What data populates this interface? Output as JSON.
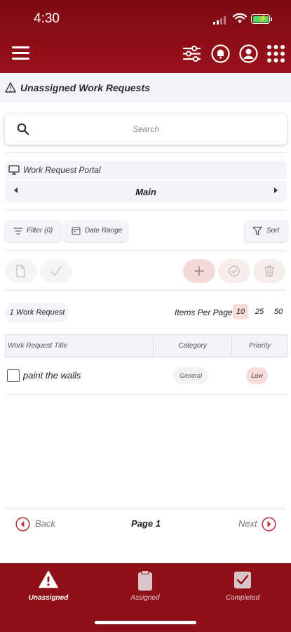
{
  "status_bar": {
    "time": "4:30"
  },
  "header": {
    "title": "Unassigned Work Requests"
  },
  "search": {
    "placeholder": "Search"
  },
  "portal": {
    "label": "Work Request Portal",
    "selected": "Main"
  },
  "filters": {
    "filter_label": "Filter (0)",
    "date_range_label": "Date Range",
    "sort_label": "Sort"
  },
  "list_info": {
    "count_label": "1 Work Request",
    "items_per_page_label": "Items Per Page",
    "page_size_options": [
      "10",
      "25",
      "50"
    ],
    "selected_page_size": "10"
  },
  "table": {
    "columns": [
      "Work Request Title",
      "Category",
      "Priority"
    ],
    "rows": [
      {
        "title": "paint the walls",
        "category": "General",
        "priority": "Low"
      }
    ]
  },
  "pagination": {
    "back_label": "Back",
    "page_label": "Page 1",
    "next_label": "Next"
  },
  "bottom_nav": {
    "items": [
      {
        "label": "Unassigned",
        "icon": "warning-icon",
        "active": true
      },
      {
        "label": "Assigned",
        "icon": "clipboard-icon",
        "active": false
      },
      {
        "label": "Completed",
        "icon": "checkbox-icon",
        "active": false
      }
    ]
  },
  "colors": {
    "brand": "#8f0f18",
    "accent_light": "#f8dcdc",
    "panel": "#f2f4f7"
  }
}
